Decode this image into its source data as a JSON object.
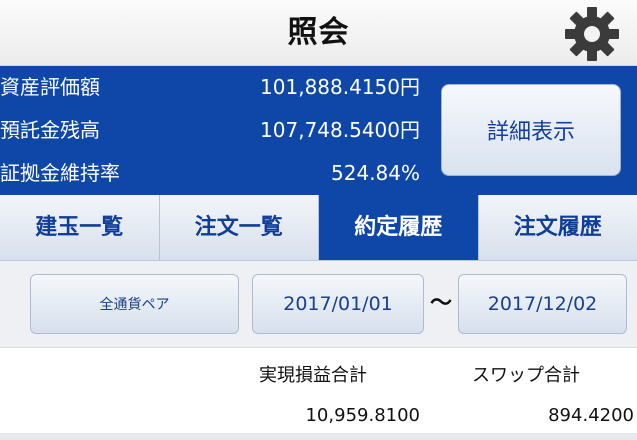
{
  "header": {
    "title": "照会",
    "settings_icon": "gear-icon"
  },
  "summary": {
    "rows": [
      {
        "label": "資産評価額",
        "value": "101,888.4150円"
      },
      {
        "label": "預託金残高",
        "value": "107,748.5400円"
      },
      {
        "label": "証拠金維持率",
        "value": "524.84%"
      }
    ],
    "detail_button": "詳細表示"
  },
  "tabs": [
    {
      "label": "建玉一覧",
      "active": false
    },
    {
      "label": "注文一覧",
      "active": false
    },
    {
      "label": "約定履歴",
      "active": true
    },
    {
      "label": "注文履歴",
      "active": false
    }
  ],
  "filter": {
    "pair": "全通貨ペア",
    "date_from": "2017/01/01",
    "separator": "～",
    "date_to": "2017/12/02"
  },
  "totals": {
    "realized_label": "実現損益合計",
    "swap_label": "スワップ合計",
    "realized_value": "10,959.8100",
    "swap_value": "894.4200"
  },
  "colors": {
    "brand_blue": "#0f47a8",
    "tab_text": "#0f3d97",
    "header_bg": "#f5f5f5"
  }
}
